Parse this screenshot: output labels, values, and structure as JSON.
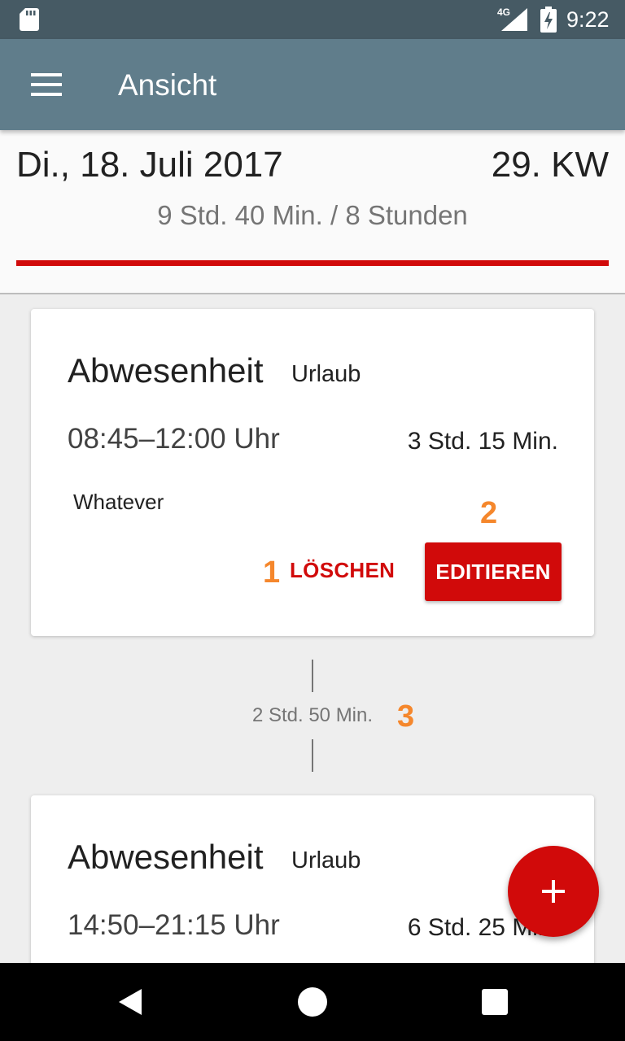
{
  "status_bar": {
    "network": "4G",
    "time": "9:22",
    "icons": [
      "sd-card-icon",
      "signal-icon",
      "battery-charging-icon"
    ]
  },
  "app_bar": {
    "title": "Ansicht",
    "menu_icon": "hamburger-menu-icon"
  },
  "day": {
    "date": "Di., 18. Juli 2017",
    "week": "29. KW",
    "summary": "9 Std. 40 Min. / 8 Stunden",
    "progress_fraction": 1.0
  },
  "entries": [
    {
      "type": "Abwesenheit",
      "subtype": "Urlaub",
      "time": "08:45–12:00 Uhr",
      "duration": "3 Std. 15 Min.",
      "note": "Whatever",
      "delete_label": "LÖSCHEN",
      "edit_label": "EDITIEREN"
    },
    {
      "type": "Abwesenheit",
      "subtype": "Urlaub",
      "time": "14:50–21:15 Uhr",
      "duration": "6 Std. 25 Min."
    }
  ],
  "gap": {
    "label": "2 Std. 50 Min."
  },
  "annotations": {
    "a1": "1",
    "a2": "2",
    "a3": "3"
  },
  "colors": {
    "status_bar": "#465a64",
    "app_bar": "#607d8b",
    "accent": "#d10a0a",
    "annotation": "#f5872c"
  },
  "fab": {
    "icon": "plus-icon"
  },
  "nav_bar": {
    "icons": [
      "back-icon",
      "home-icon",
      "recents-icon"
    ]
  }
}
